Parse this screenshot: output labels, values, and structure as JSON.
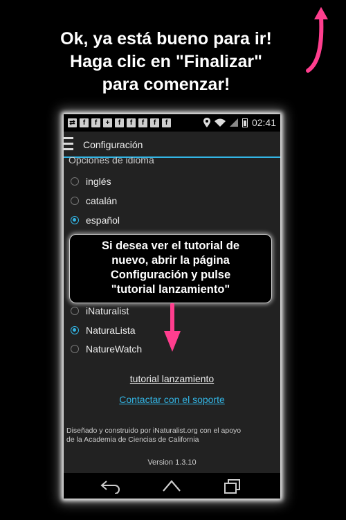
{
  "headline": {
    "line1": "Ok, ya está bueno para ir!",
    "line2": "Haga clic en \"Finalizar\"",
    "line3": "para comenzar!"
  },
  "colors": {
    "accent": "#33b5e5",
    "arrow": "#ff3e8e",
    "background": "#000000",
    "phone_bg": "#222222"
  },
  "status_bar": {
    "time": "02:41",
    "notification_icons": [
      "usb-icon",
      "facebook-icon",
      "facebook-icon",
      "add-contact-icon",
      "facebook-icon",
      "facebook-icon",
      "facebook-icon",
      "facebook-icon",
      "facebook-icon"
    ],
    "fb_glyph": "f",
    "usb_glyph": "⇄",
    "contact_glyph": "+"
  },
  "action_bar": {
    "title": "Configuración"
  },
  "language_section": {
    "header": "Opciones de idioma",
    "options": [
      {
        "label": "inglés",
        "checked": false
      },
      {
        "label": "catalán",
        "checked": false
      },
      {
        "label": "español",
        "checked": true
      }
    ]
  },
  "network_section": {
    "options": [
      {
        "label": "iNaturalist",
        "checked": false
      },
      {
        "label": "NaturaLista",
        "checked": true
      },
      {
        "label": "NatureWatch",
        "checked": false
      }
    ]
  },
  "tutorial_link": "tutorial lanzamiento",
  "support_link": "Contactar con el soporte",
  "credit_line1": "Diseñado y construido por iNaturalist.org con el apoyo",
  "credit_line2": "de la Academia de Ciencias de California",
  "version": "Version 1.3.10",
  "tooltip": {
    "line1": "Si desea ver el tutorial de",
    "line2": "nuevo, abrir la página",
    "line3": "Configuración y pulse",
    "line4": "\"tutorial lanzamiento\""
  },
  "nav_buttons": [
    "back-icon",
    "home-icon",
    "recents-icon"
  ]
}
